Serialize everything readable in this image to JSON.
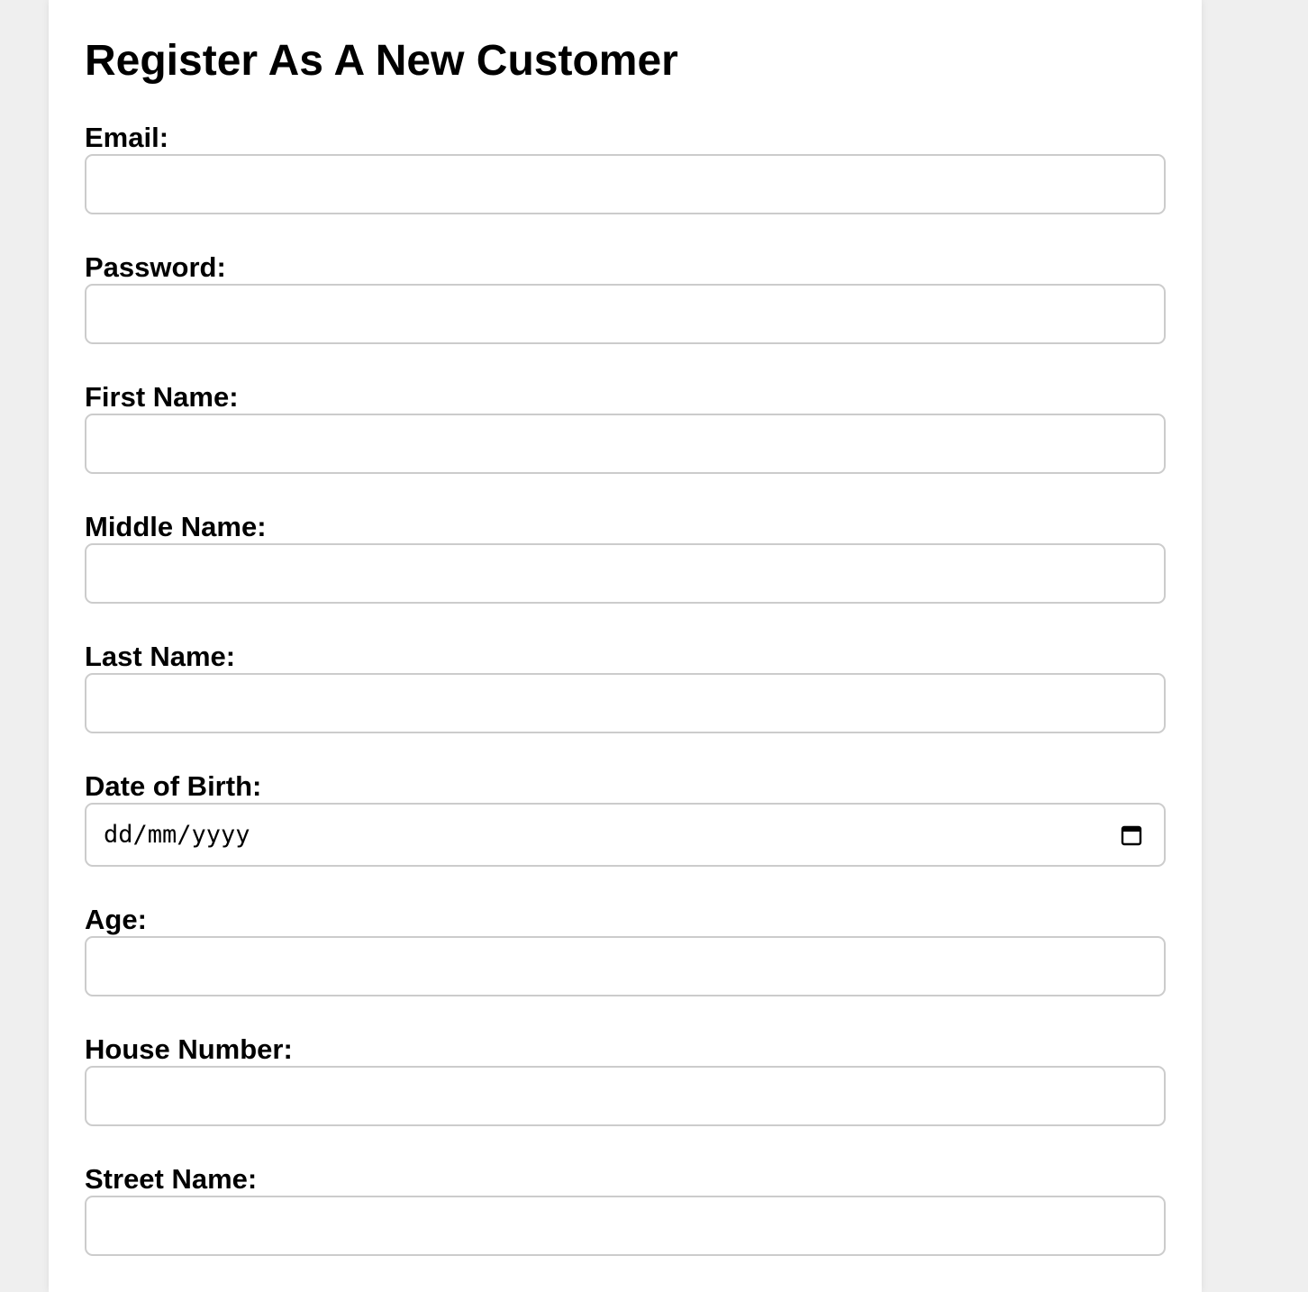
{
  "form": {
    "title": "Register As A New Customer",
    "fields": {
      "email": {
        "label": "Email:",
        "value": ""
      },
      "password": {
        "label": "Password:",
        "value": ""
      },
      "first_name": {
        "label": "First Name:",
        "value": ""
      },
      "middle_name": {
        "label": "Middle Name:",
        "value": ""
      },
      "last_name": {
        "label": "Last Name:",
        "value": ""
      },
      "date_of_birth": {
        "label": "Date of Birth:",
        "placeholder": "dd/mm/yyyy",
        "icon": "calendar-icon"
      },
      "age": {
        "label": "Age:",
        "value": ""
      },
      "house_number": {
        "label": "House Number:",
        "value": ""
      },
      "street_name": {
        "label": "Street Name:",
        "value": ""
      }
    }
  },
  "colors": {
    "page_background": "#efefef",
    "card_background": "#ffffff",
    "input_border": "#cccccc",
    "text": "#000000"
  }
}
